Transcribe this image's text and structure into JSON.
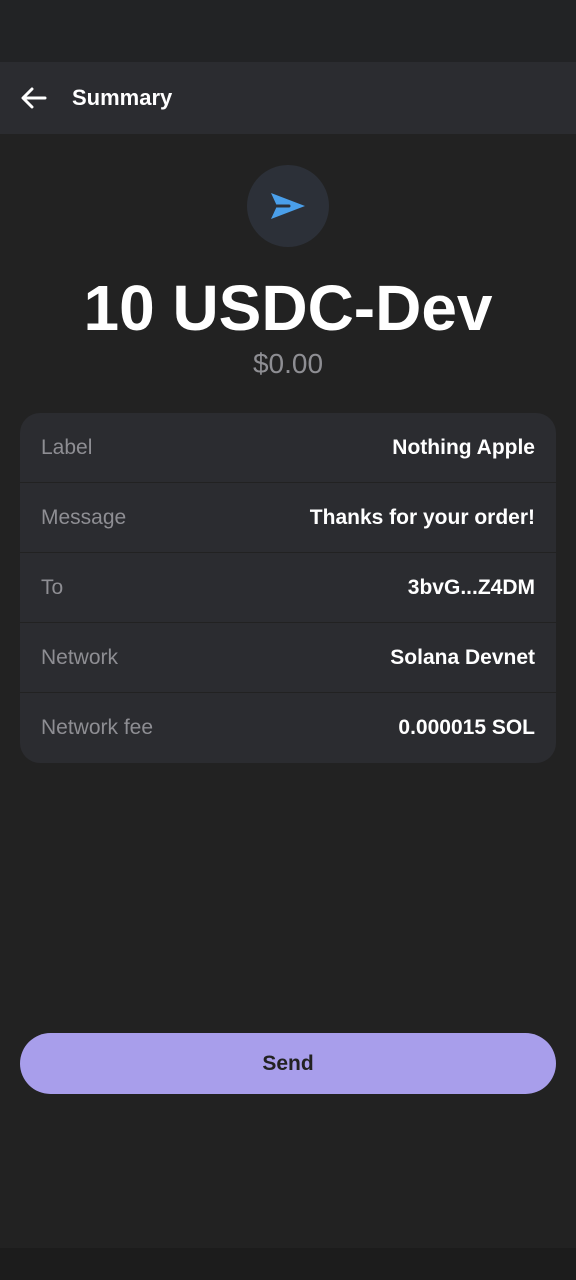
{
  "header": {
    "title": "Summary",
    "back_icon": "arrow-left-icon"
  },
  "hero": {
    "icon": "paper-plane-icon",
    "icon_color": "#4a9fea",
    "amount": "10 USDC-Dev",
    "fiat_value": "$0.00"
  },
  "details": [
    {
      "label": "Label",
      "value": "Nothing Apple"
    },
    {
      "label": "Message",
      "value": "Thanks for your order! "
    },
    {
      "label": "To",
      "value": "3bvG...Z4DM"
    },
    {
      "label": "Network",
      "value": "Solana Devnet"
    },
    {
      "label": "Network fee",
      "value": "0.000015 SOL"
    }
  ],
  "actions": {
    "send_label": "Send",
    "send_color": "#a89eeb"
  }
}
